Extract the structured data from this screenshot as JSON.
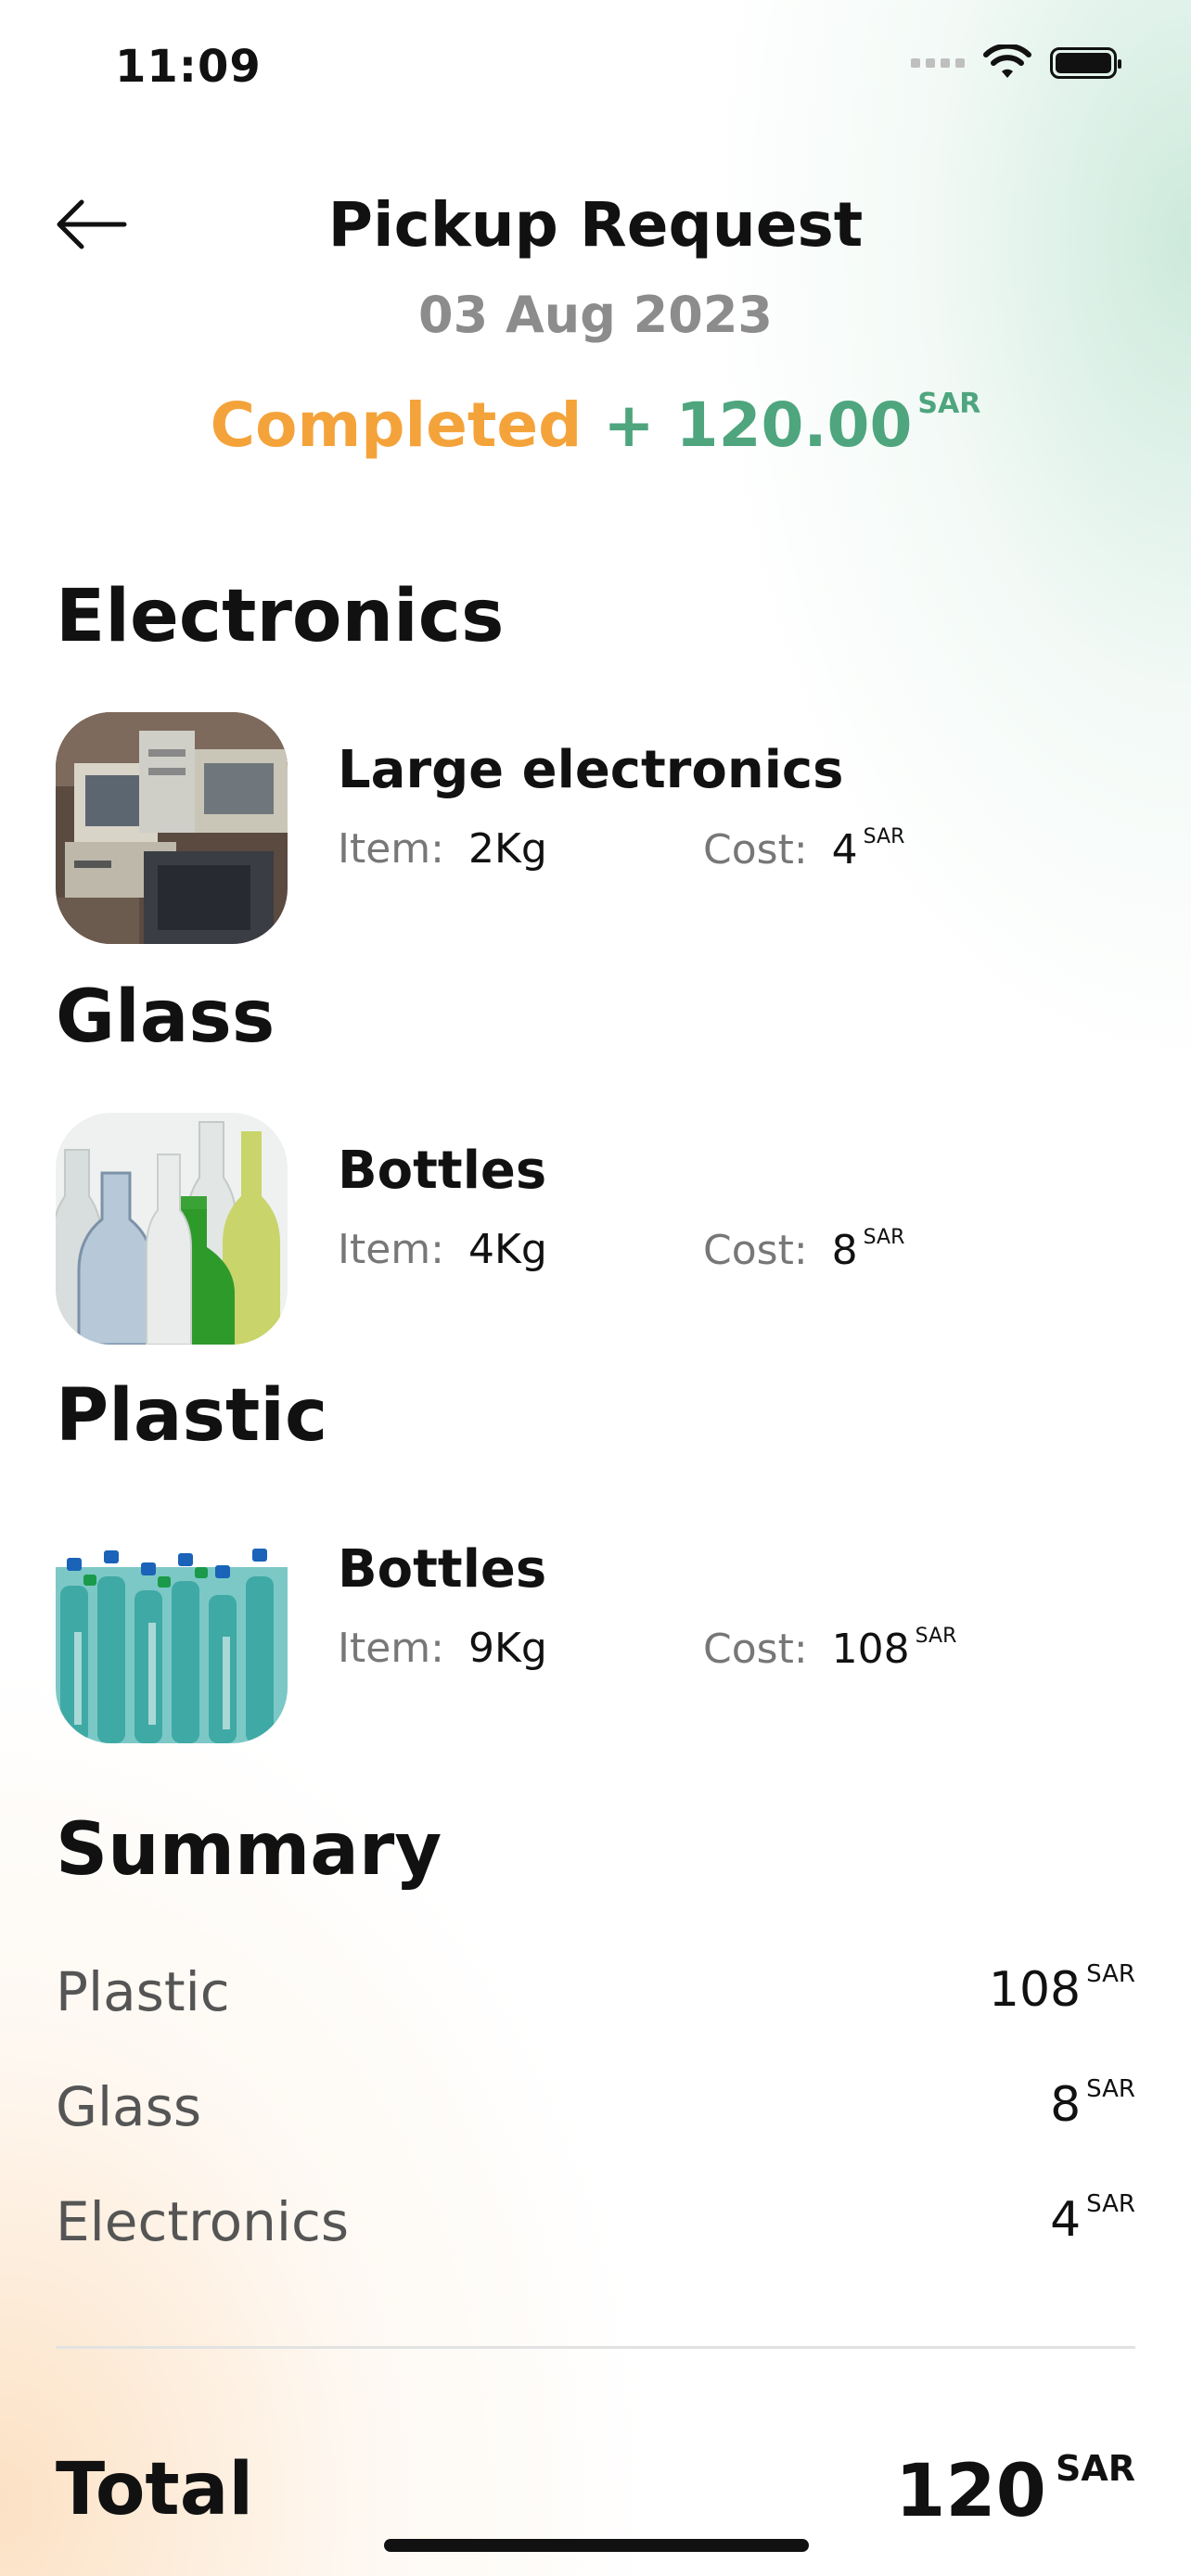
{
  "status_bar": {
    "time": "11:09"
  },
  "header": {
    "title": "Pickup Request",
    "date": "03 Aug 2023",
    "status": "Completed",
    "amount": "+ 120.00",
    "currency": "SAR"
  },
  "categories": [
    {
      "title": "Electronics",
      "item": {
        "name": "Large electronics",
        "item_label": "Item:",
        "weight": "2Kg",
        "cost_label": "Cost:",
        "cost": "4",
        "currency": "SAR"
      }
    },
    {
      "title": "Glass",
      "item": {
        "name": "Bottles",
        "item_label": "Item:",
        "weight": "4Kg",
        "cost_label": "Cost:",
        "cost": "8",
        "currency": "SAR"
      }
    },
    {
      "title": "Plastic",
      "item": {
        "name": "Bottles",
        "item_label": "Item:",
        "weight": "9Kg",
        "cost_label": "Cost:",
        "cost": "108",
        "currency": "SAR"
      }
    }
  ],
  "summary": {
    "title": "Summary",
    "rows": [
      {
        "label": "Plastic",
        "value": "108",
        "currency": "SAR"
      },
      {
        "label": "Glass",
        "value": "8",
        "currency": "SAR"
      },
      {
        "label": "Electronics",
        "value": "4",
        "currency": "SAR"
      }
    ],
    "total_label": "Total",
    "total_value": "120",
    "total_currency": "SAR"
  },
  "colors": {
    "completed": "#f4a33a",
    "amount": "#4ea57e"
  }
}
